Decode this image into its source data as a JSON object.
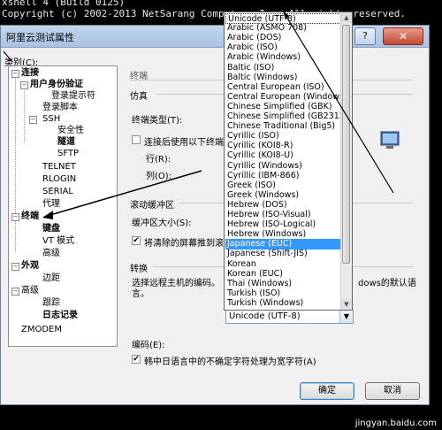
{
  "terminal": {
    "line1": "xshell 4 (Build 0125)",
    "line2": "Copyright (c) 2002-2013 NetSarang Computer, Inc. All rights reserved."
  },
  "dialog": {
    "title": "阿里云测试属性",
    "help": "?",
    "close": "✕",
    "category_label": "类别(C):"
  },
  "tree": {
    "connection": "连接",
    "user_auth": "用户身份验证",
    "login_prompt": "登录提示符",
    "login_script": "登录脚本",
    "ssh": "SSH",
    "security": "安全性",
    "tunnel": "隧道",
    "sftp": "SFTP",
    "telnet": "TELNET",
    "rlogin": "RLOGIN",
    "serial": "SERIAL",
    "proxy": "代理",
    "terminal": "终端",
    "keyboard": "键盘",
    "vt_mode": "VT 模式",
    "advanced1": "高级",
    "appearance": "外观",
    "margin": "边距",
    "advanced2": "高级",
    "trace": "跟踪",
    "log": "日志记录",
    "zmodem": "ZMODEM"
  },
  "panel": {
    "heading": "终端",
    "emulation": "仿真",
    "terminal_type": "终端类型(T):",
    "use_size": "连接后使用以下终端",
    "rows": "行(R):",
    "cols": "列(O):",
    "scroll_buffer": "滚动缓冲区",
    "buffer_size": "缓冲区大小(S):",
    "push_cleared": "将清除的屏幕推到滚",
    "convert": "转换",
    "convert_desc_a": "选择远程主机的编码。",
    "convert_desc_b": "dows的默认语",
    "convert_desc_c": "言。",
    "encoding_label": "编码(E):",
    "encoding_value": "Unicode (UTF-8)",
    "cjk_wide": "韩中日语言中的不确定字符处理为宽字符(A)",
    "ok": "确定",
    "cancel": "取消"
  },
  "encoding_options": [
    "Unicode (UTF-8)",
    "Arabic (ASMO 708)",
    "Arabic (DOS)",
    "Arabic (ISO)",
    "Arabic (Windows)",
    "Baltic (ISO)",
    "Baltic (Windows)",
    "Central European (ISO)",
    "Central European (Windows)",
    "Chinese Simplified (GBK)",
    "Chinese Simplified (GB2312)",
    "Chinese Traditional (Big5)",
    "Cyrillic (ISO)",
    "Cyrillic (KOI8-R)",
    "Cyrillic (KOI8-U)",
    "Cyrillic (Windows)",
    "Cyrillic (IBM-866)",
    "Greek (ISO)",
    "Greek (Windows)",
    "Hebrew (DOS)",
    "Hebrew (ISO-Visual)",
    "Hebrew (ISO-Logical)",
    "Hebrew (Windows)",
    "Japanese (EUC)",
    "Japanese (Shift-JIS)",
    "Korean",
    "Korean (EUC)",
    "Thai (Windows)",
    "Turkish (ISO)",
    "Turkish (Windows)"
  ],
  "selected_option": "Japanese (EUC)",
  "watermark": "jingyan.baidu.com",
  "colors": {
    "selection": "#3399ff",
    "accent": "#7a9cc4",
    "close": "#c34a33"
  }
}
